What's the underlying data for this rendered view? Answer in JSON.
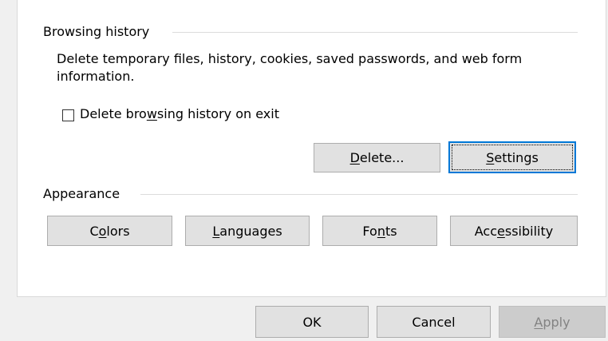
{
  "browsing_history": {
    "group_title": "Browsing history",
    "description": "Delete temporary files, history, cookies, saved passwords, and web form information.",
    "checkbox": {
      "label_before": "Delete bro",
      "label_accel": "w",
      "label_after": "sing history on exit",
      "checked": false
    },
    "delete_button": {
      "accel": "D",
      "rest": "elete..."
    },
    "settings_button": {
      "accel": "S",
      "rest": "ettings"
    }
  },
  "appearance": {
    "group_title": "Appearance",
    "colors_button": {
      "before": "C",
      "accel": "o",
      "after": "lors"
    },
    "languages_button": {
      "before": "",
      "accel": "L",
      "after": "anguages"
    },
    "fonts_button": {
      "before": "Fo",
      "accel": "n",
      "after": "ts"
    },
    "accessibility_button": {
      "before": "Acc",
      "accel": "e",
      "after": "ssibility"
    }
  },
  "footer": {
    "ok_label": "OK",
    "cancel_label": "Cancel",
    "apply_button": {
      "accel": "A",
      "rest": "pply",
      "disabled": true
    }
  }
}
